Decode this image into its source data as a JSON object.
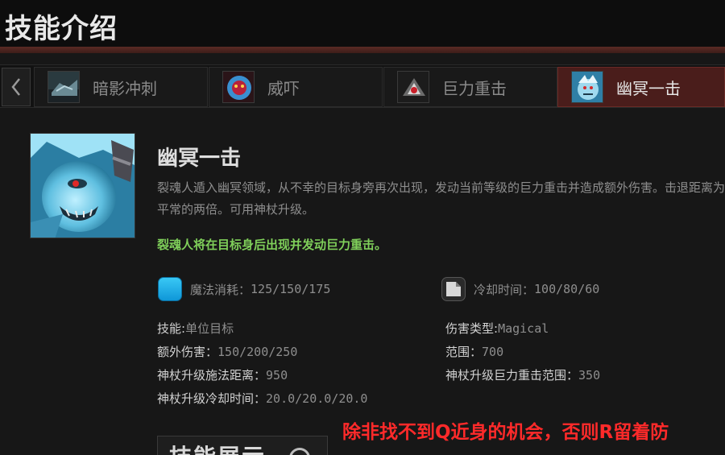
{
  "header": {
    "title": "技能介绍"
  },
  "tabs": [
    {
      "label": "暗影冲刺",
      "icon": "shadow-dash-icon",
      "active": false
    },
    {
      "label": "威吓",
      "icon": "intimidate-icon",
      "active": false
    },
    {
      "label": "巨力重击",
      "icon": "greater-bash-icon",
      "active": false
    },
    {
      "label": "幽冥一击",
      "icon": "nether-strike-icon",
      "active": true
    }
  ],
  "skill": {
    "name": "幽冥一击",
    "portrait_icon": "spirit-breaker-portrait-icon",
    "description": "裂魂人遁入幽冥领域，从不幸的目标身旁再次出现，发动当前等级的巨力重击并造成额外伤害。击退距离为平常的两倍。可用神杖升级。",
    "note": "裂魂人将在目标身后出现并发动巨力重击。",
    "mana": {
      "label": "魔法消耗：",
      "value": "125/150/175"
    },
    "cooldown": {
      "label": "冷却时间：",
      "value": "100/80/60"
    },
    "attributes": [
      {
        "key": "技能:",
        "value": "单位目标"
      },
      {
        "key": "伤害类型:",
        "value": "Magical"
      },
      {
        "key": "额外伤害：",
        "value": "150/200/250"
      },
      {
        "key": "范围：",
        "value": "700"
      },
      {
        "key": "神杖升级施法距离：",
        "value": "950"
      },
      {
        "key": "神杖升级巨力重击范围：",
        "value": "350"
      },
      {
        "key": "神杖升级冷却时间：",
        "value": "20.0/20.0/20.0"
      }
    ]
  },
  "demo": {
    "label": "技能展示"
  },
  "overlay": {
    "text": "除非找不到Q近身的机会，否则R留着防"
  },
  "colors": {
    "accent": "#4a1d1b",
    "mana": "#1aa8e6",
    "note": "#7fcf5a",
    "overlay": "#ff2a2a"
  }
}
